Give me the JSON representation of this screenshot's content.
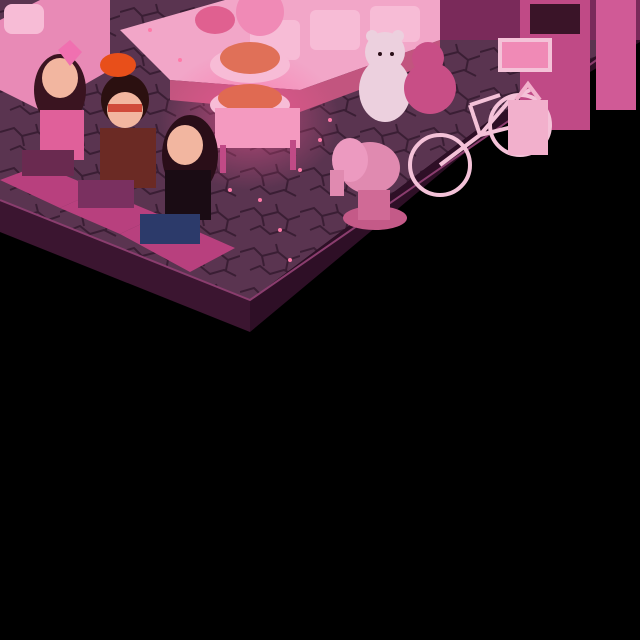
{
  "scene": {
    "background": "#000000",
    "floor_color": "#5a3450",
    "floor_crack_color": "#3a1e34",
    "floor_edge_color": "#8a3d6e",
    "floor_side_color": "#3b1530",
    "wall_color": "#7a2a5a",
    "carpet_color": "#b8407e",
    "accent_pink": "#f06aa8"
  },
  "furniture": [
    {
      "name": "pink-sofa",
      "kind": "sofa"
    },
    {
      "name": "pink-teddy-bear",
      "kind": "teddy"
    },
    {
      "name": "pink-bear-plush",
      "kind": "bear"
    },
    {
      "name": "pink-bicycle",
      "kind": "bicycle"
    },
    {
      "name": "pink-elephant-statue",
      "kind": "elephant"
    },
    {
      "name": "candy-table",
      "kind": "table"
    },
    {
      "name": "pink-dragon-lamp",
      "kind": "lamp"
    },
    {
      "name": "floor-cushion",
      "kind": "cushion"
    }
  ],
  "avatars": [
    {
      "name": "avatar-girl-pink-hair",
      "hair": "#3a1420",
      "shirt": "#e0609a",
      "pants": "#6a2a50"
    },
    {
      "name": "avatar-boy-sunglasses",
      "hair": "#2b1010",
      "shirt": "#6b2a24",
      "pants": "#7a3060"
    },
    {
      "name": "avatar-girl-black-top",
      "hair": "#2a0e18",
      "shirt": "#1a0c14",
      "pants": "#2c3a6a"
    }
  ]
}
